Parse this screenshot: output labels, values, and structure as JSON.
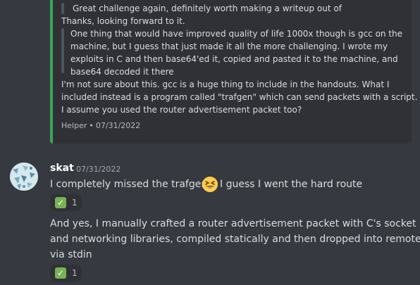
{
  "embed": {
    "accent_color": "#3ba55c",
    "lines": [
      "Great challenge again, definitely worth making a writeup out of",
      "Thanks, looking forward to it.",
      "One thing that would have improved quality of life 1000x though is gcc on the",
      "machine, but I guess that just made it all the more challenging. I wrote my",
      "exploits in C and then base64'ed it, copied and pasted it to the machine, and",
      "base64 decoded it there",
      "I'm not sure about this. gcc is a huge thing to include in the handouts. What I",
      "included instead is a program called \"trafgen\" which can send packets with a script.",
      "I assume you used the router advertisement packet too?"
    ],
    "footer": {
      "author": "Helper",
      "separator": "•",
      "date": "07/31/2022"
    }
  },
  "message": {
    "author": "skat",
    "timestamp": "07/31/2022",
    "avatar_icon": "avatar-pattern-icon",
    "line1_a": "I completely missed the trafgen!",
    "emoji_icon": "grinning-squinting-face-icon",
    "line1_b": "I guess I went the hard route",
    "reaction1": {
      "icon": "white-check-mark-icon",
      "count": "1"
    },
    "paragraph2": [
      "And yes, I manually crafted a router advertisement packet with C's socket",
      "and networking libraries, compiled statically and then dropped into remote",
      "via stdin"
    ],
    "reaction2": {
      "icon": "white-check-mark-icon",
      "count": "1"
    }
  }
}
